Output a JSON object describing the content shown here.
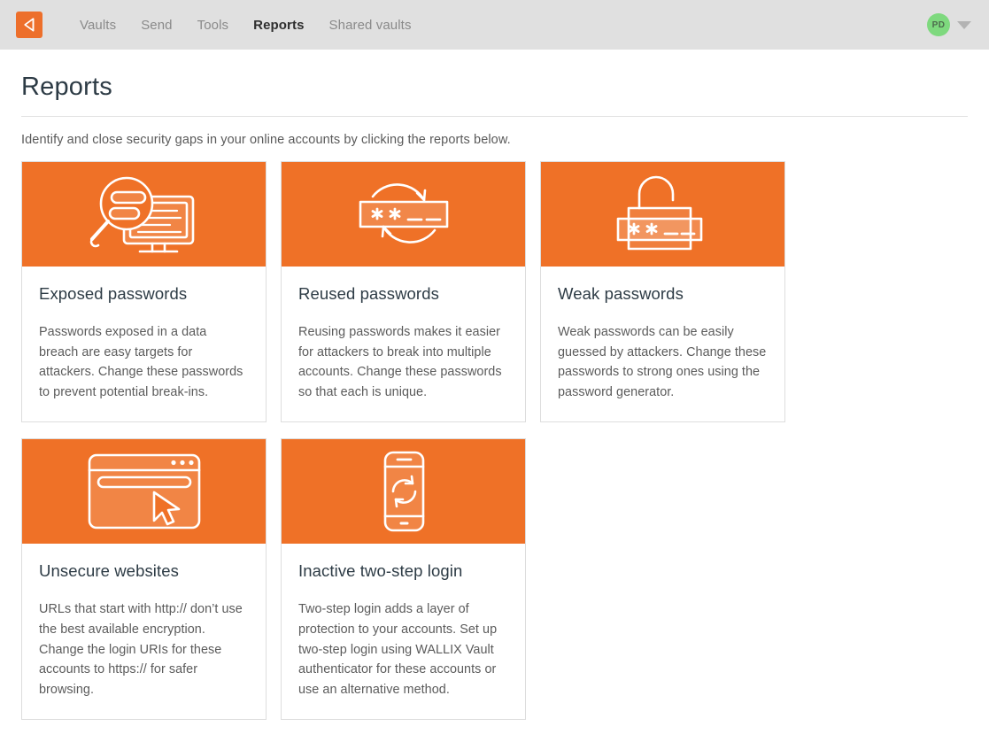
{
  "navbar": {
    "logo_icon": "wallix-logo-icon",
    "links": [
      {
        "label": "Vaults",
        "active": false
      },
      {
        "label": "Send",
        "active": false
      },
      {
        "label": "Tools",
        "active": false
      },
      {
        "label": "Reports",
        "active": true
      },
      {
        "label": "Shared vaults",
        "active": false
      }
    ],
    "avatar_initials": "PD",
    "menu_icon": "chevron-down-icon",
    "background_color": "#e0e0e0",
    "accent_color": "#ed6f2b"
  },
  "page": {
    "title": "Reports",
    "subtitle": "Identify and close security gaps in your online accounts by clicking the reports below."
  },
  "cards": [
    {
      "id": "exposed-passwords",
      "icon": "magnifier-monitor-icon",
      "title": "Exposed passwords",
      "description": "Passwords exposed in a data breach are easy targets for attackers. Change these passwords to prevent potential break-ins."
    },
    {
      "id": "reused-passwords",
      "icon": "password-field-refresh-icon",
      "title": "Reused passwords",
      "description": "Reusing passwords makes it easier for attackers to break into multiple accounts. Change these passwords so that each is unique."
    },
    {
      "id": "weak-passwords",
      "icon": "open-padlock-password-icon",
      "title": "Weak passwords",
      "description": "Weak passwords can be easily guessed by attackers. Change these passwords to strong ones using the password generator."
    },
    {
      "id": "unsecure-websites",
      "icon": "browser-window-cursor-icon",
      "title": "Unsecure websites",
      "description": "URLs that start with http:// don’t use the best available encryption. Change the login URIs for these accounts to https:// for safer browsing."
    },
    {
      "id": "inactive-two-step-login",
      "icon": "phone-sync-icon",
      "title": "Inactive two-step login",
      "description": "Two-step login adds a layer of protection to your accounts. Set up two-step login using WALLIX Vault authenticator for these accounts or use an alternative method."
    }
  ],
  "colors": {
    "card_banner_orange": "#ef7127",
    "avatar_green": "#7ed97e",
    "text_dark": "#2d3b45",
    "text_body": "#5b5b5b"
  }
}
